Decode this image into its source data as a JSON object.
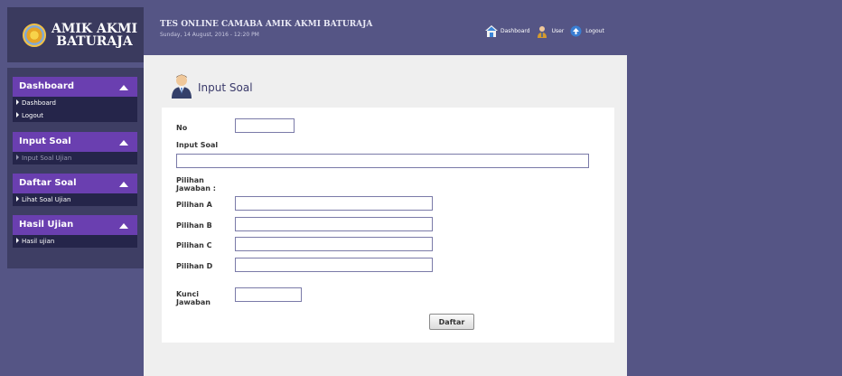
{
  "logo": {
    "line1": "AMIK AKMI",
    "line2": "BATURAJA"
  },
  "header": {
    "title": "TES ONLINE CAMABA AMIK AKMI BATURAJA",
    "datetime": "Sunday, 14 August, 2016 - 12:20 PM",
    "nav": [
      {
        "label": "Dashboard",
        "icon": "home-icon"
      },
      {
        "label": "User",
        "icon": "user-icon"
      },
      {
        "label": "Logout",
        "icon": "logout-icon"
      }
    ]
  },
  "sidebar": {
    "groups": [
      {
        "title": "Dashboard",
        "items": [
          "Dashboard",
          "Logout"
        ]
      },
      {
        "title": "Input Soal",
        "items": [
          "Input Soal Ujian"
        ]
      },
      {
        "title": "Daftar Soal",
        "items": [
          "Lihat Soal Ujian"
        ]
      },
      {
        "title": "Hasil Ujian",
        "items": [
          "Hasil ujian"
        ]
      }
    ]
  },
  "page": {
    "title": "Input Soal"
  },
  "form": {
    "no_label": "No",
    "soal_label": "Input Soal",
    "pilihan_label_1": "Pilihan",
    "pilihan_label_2": "Jawaban :",
    "a_label": "Pilihan A",
    "b_label": "Pilihan B",
    "c_label": "Pilihan C",
    "d_label": "Pilihan D",
    "kunci_label_1": "Kunci",
    "kunci_label_2": "Jawaban",
    "submit_label": "Daftar",
    "values": {
      "no": "",
      "soal": "",
      "a": "",
      "b": "",
      "c": "",
      "d": "",
      "kunci": ""
    }
  },
  "colors": {
    "background": "#555585",
    "sidebar_group": "#6a3fb0",
    "sidebar_item": "#25254a",
    "content": "#efefef"
  }
}
